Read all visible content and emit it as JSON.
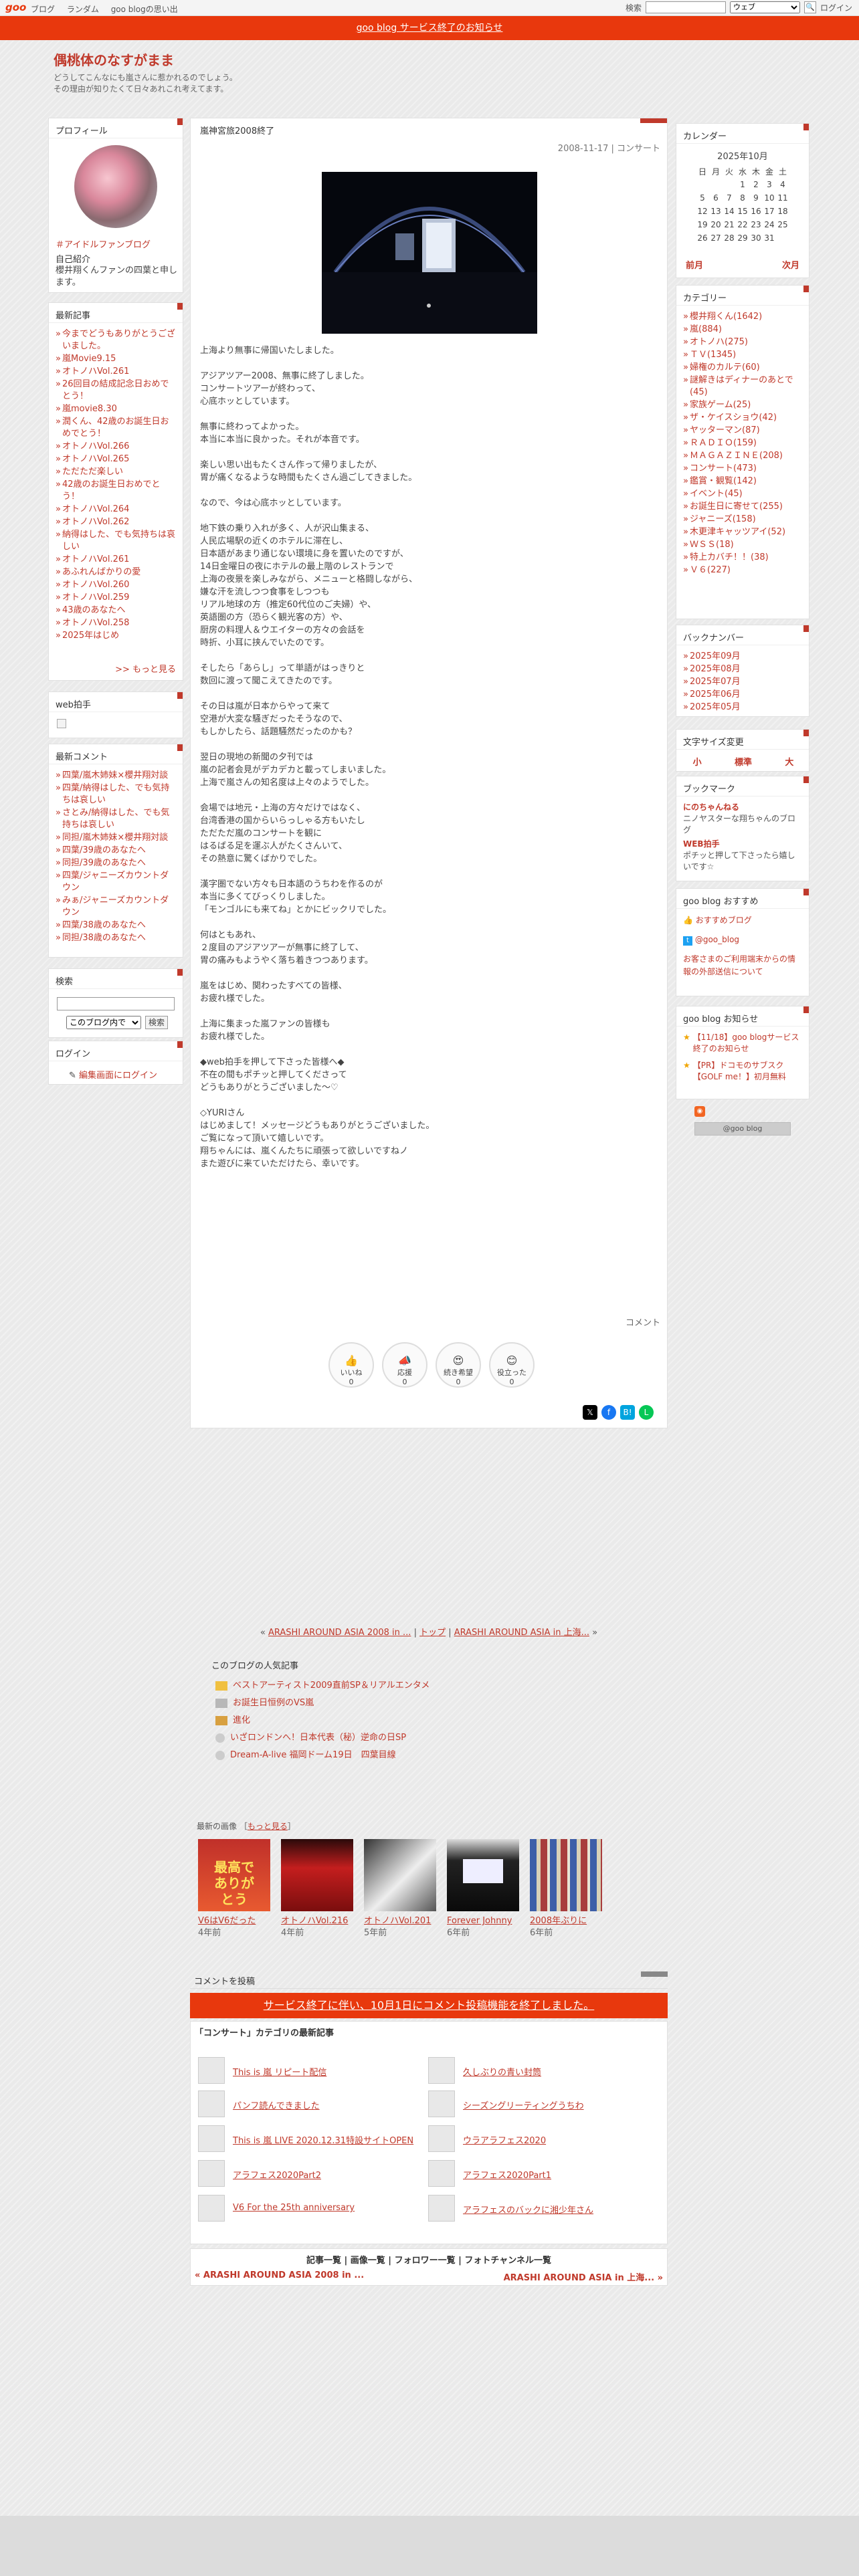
{
  "topbar": {
    "logo": "goo",
    "nav": [
      "ブログ",
      "ランダム",
      "goo blogの思い出"
    ],
    "search_label": "検索",
    "search_scope": "ウェブ",
    "login": "ログイン"
  },
  "banner": {
    "text": "goo blog サービス終了のお知らせ"
  },
  "blog": {
    "title": "偶桃体のなすがまま",
    "desc_lines": [
      "どうしてこんなにも嵐さんに惹かれるのでしょう。",
      "その理由が知りたくて日々あれこれ考えてます。"
    ]
  },
  "profile": {
    "heading": "プロフィール",
    "fan_link": "＃アイドルファンブログ",
    "intro_heading": "自己紹介",
    "intro": "櫻井翔くんファンの四葉と申します。"
  },
  "recent": {
    "heading": "最新記事",
    "items": [
      "今までどうもありがとうございました。",
      "嵐Movie9.15",
      "オトノハVol.261",
      "26回目の結成記念日おめでとう！",
      "嵐movie8.30",
      "潤くん、42歳のお誕生日おめでとう！",
      "オトノハVol.266",
      "オトノハVol.265",
      "ただただ楽しい",
      "42歳のお誕生日おめでとう！",
      "オトノハVol.264",
      "オトノハVol.262",
      "納得はした、でも気持ちは哀しい",
      "オトノハVol.261",
      "あふれんばかりの愛",
      "オトノハVol.260",
      "オトノハVol.259",
      "43歳のあなたへ",
      "オトノハVol.258",
      "2025年はじめ"
    ],
    "more": ">> もっと見る"
  },
  "webclap": {
    "heading": "web拍手"
  },
  "comments_recent": {
    "heading": "最新コメント",
    "items": [
      "四葉/嵐木姉妹×櫻井翔対談",
      "四葉/納得はした、でも気持ちは哀しい",
      "さとみ/納得はした、でも気持ちは哀しい",
      "同担/嵐木姉妹×櫻井翔対談",
      "四葉/39歳のあなたへ",
      "同担/39歳のあなたへ",
      "四葉/ジャニーズカウントダウン",
      "みぁ/ジャニーズカウントダウン",
      "四葉/38歳のあなたへ",
      "同担/38歳のあなたへ"
    ]
  },
  "search": {
    "heading": "検索",
    "scope": "このブログ内で",
    "button": "検索"
  },
  "login": {
    "heading": "ログイン",
    "link": "編集画面にログイン"
  },
  "article": {
    "title": "嵐神宮旅2008終了",
    "meta": "2008-11-17 | コンサート",
    "paragraphs": [
      "上海より無事に帰国いたしました。",
      "アジアツアー2008、無事に終了しました。\nコンサートツアーが終わって、\n心底ホッとしています。",
      "無事に終わってよかった。\n本当に本当に良かった。それが本音です。",
      "楽しい思い出もたくさん作って帰りましたが、\n胃が痛くなるような時間もたくさん過ごしてきました。",
      "なので、今は心底ホッとしています。",
      "地下鉄の乗り入れが多く、人が沢山集まる、\n人民広場駅の近くのホテルに滞在し、\n日本語があまり通じない環境に身を置いたのですが、\n14日金曜日の夜にホテルの最上階のレストランで\n上海の夜景を楽しみながら、メニューと格闘しながら、\n嫌な汗を流しつつ食事をしつつも\nリアル地球の方（推定60代位のご夫婦）や、\n英語圏の方（恐らく観光客の方）や、\n厨房の料理人＆ウエイターの方々の会話を\n時折、小耳に挟んでいたのです。",
      "そしたら「あらし」って単語がはっきりと\n数回に渡って聞こえてきたのです。",
      "その日は嵐が日本からやって来て\n空港が大変な騒ぎだったそうなので、\nもしかしたら、話題騒然だったのかも？",
      "翌日の現地の新聞の夕刊では\n嵐の記者会見がデカデカと載ってしまいました。\n上海で嵐さんの知名度は上々のようでした。",
      "会場では地元・上海の方々だけではなく、\n台湾香港の国からいらっしゃる方もいたし\nただただ嵐のコンサートを観に\nはるばる足を運ぶ人がたくさんいて、\nその熱意に驚くばかりでした。",
      "漢字圏でない方々も日本語のうちわを作るのが\n本当に多くてびっくりしました。\n「モンゴルにも来てね」とかにビックリでした。",
      "何はともあれ、\n２度目のアジアツアーが無事に終了して、\n胃の痛みもようやく落ち着きつつあります。",
      "嵐をはじめ、関わったすべての皆様、\nお疲れ様でした。",
      "上海に集まった嵐ファンの皆様も\nお疲れ様でした。",
      "◆web拍手を押して下さった皆様へ◆\n不在の間もポチッと押してくださって\nどうもありがとうございました〜♡",
      "◇YURIさん\nはじめまして！メッセージどうもありがとうございました。\nご覧になって頂いて嬉しいです。\n翔ちゃんには、嵐くんたちに頑張って欲しいですねノ\nまた遊びに来ていただけたら、幸いです。"
    ],
    "comment_label": "コメント",
    "reactions": [
      {
        "label": "いいね",
        "count": "0"
      },
      {
        "label": "応援",
        "count": "0"
      },
      {
        "label": "続き希望",
        "count": "0"
      },
      {
        "label": "役立った",
        "count": "0"
      }
    ]
  },
  "calendar": {
    "heading": "カレンダー",
    "month": "2025年10月",
    "days": [
      "日",
      "月",
      "火",
      "水",
      "木",
      "金",
      "土"
    ],
    "weeks": [
      [
        "",
        "",
        "",
        "1",
        "2",
        "3",
        "4"
      ],
      [
        "5",
        "6",
        "7",
        "8",
        "9",
        "10",
        "11"
      ],
      [
        "12",
        "13",
        "14",
        "15",
        "16",
        "17",
        "18"
      ],
      [
        "19",
        "20",
        "21",
        "22",
        "23",
        "24",
        "25"
      ],
      [
        "26",
        "27",
        "28",
        "29",
        "30",
        "31",
        ""
      ]
    ],
    "prev": "前月",
    "next": "次月"
  },
  "categories": {
    "heading": "カテゴリー",
    "items": [
      "櫻井翔くん(1642)",
      "嵐(884)",
      "オトノハ(275)",
      "ＴＶ(1345)",
      "婦権のカルテ(60)",
      "謎解きはディナーのあとで(45)",
      "家族ゲーム(25)",
      "ザ・ケイスショウ(42)",
      "ヤッターマン(87)",
      "ＲＡＤＩＯ(159)",
      "ＭＡＧＡＺＩＮＥ(208)",
      "コンサート(473)",
      "鑑賞・観覧(142)",
      "イベント(45)",
      "お誕生日に寄せて(255)",
      "ジャニーズ(158)",
      "木更津キャッツアイ(52)",
      "ＷＳＳ(18)",
      "特上カバチ！！(38)",
      "Ｖ６(227)"
    ]
  },
  "backnumber": {
    "heading": "バックナンバー",
    "items": [
      "2025年09月",
      "2025年08月",
      "2025年07月",
      "2025年06月",
      "2025年05月"
    ]
  },
  "fontsize": {
    "heading": "文字サイズ変更",
    "small": "小",
    "normal": "標準",
    "large": "大"
  },
  "bookmark": {
    "heading": "ブックマーク",
    "items": [
      {
        "title": "にのちゃんねる",
        "desc": "ニノヤスターな翔ちゃんのブログ"
      },
      {
        "title": "WEB拍手",
        "desc": "ポチッと押して下さったら嬉しいです☆"
      }
    ]
  },
  "goo_recommend": {
    "heading": "goo blog おすすめ",
    "items": [
      "おすすめブログ",
      "@goo_blog"
    ],
    "notice": "お客さまのご利用端末からの情報の外部送信について"
  },
  "goo_news": {
    "heading": "goo blog お知らせ",
    "items": [
      "【11/18】goo blogサービス終了のお知らせ",
      "【PR】ドコモのサブスク【GOLF me！】初月無料"
    ]
  },
  "goo_badge": "@goo blog",
  "pager": {
    "prev": "ARASHI AROUND ASIA 2008 in ...",
    "top": "トップ",
    "next": "ARASHI AROUND ASIA in 上海..."
  },
  "popular": {
    "heading": "このブログの人気記事",
    "items": [
      "ベストアーティスト2009直前SP＆リアルエンタメ",
      "お誕生日恒例のVS嵐",
      "進化",
      "いざロンドンへ！日本代表（秘）逆命の日SP",
      "Dream-A-live 福岡ドーム19日　四葉目線"
    ]
  },
  "recent_images": {
    "heading": "最新の画像",
    "more": "もっと見る",
    "items": [
      {
        "title": "V6はV6だった",
        "age": "4年前"
      },
      {
        "title": "オトノハVol.216",
        "age": "4年前"
      },
      {
        "title": "オトノハVol.201",
        "age": "5年前"
      },
      {
        "title": "Forever Johnny",
        "age": "6年前"
      },
      {
        "title": "2008年ぶりに",
        "age": "6年前"
      }
    ]
  },
  "post_comment": {
    "heading": "コメントを投稿",
    "banner": "サービス終了に伴い、10月1日にコメント投稿機能を終了しました。"
  },
  "category_latest": {
    "heading": "「コンサート」カテゴリの最新記事",
    "left": [
      "This is 嵐 リピート配信",
      "パンフ読んできました",
      "This is 嵐 LIVE 2020.12.31特設サイトOPEN",
      "アラフェス2020Part2",
      "V6 For the 25th anniversary"
    ],
    "right": [
      "久しぶりの青い封筒",
      "シーズングリーティングうちわ",
      "ウラアラフェス2020",
      "アラフェス2020Part1",
      "アラフェスのバックに湘少年さん"
    ]
  },
  "bottom_links": {
    "items": [
      "記事一覧",
      "画像一覧",
      "フォロワー一覧",
      "フォトチャンネル一覧"
    ],
    "prev": "« ARASHI AROUND ASIA 2008 in ...",
    "next": "ARASHI AROUND ASIA in 上海... »"
  }
}
